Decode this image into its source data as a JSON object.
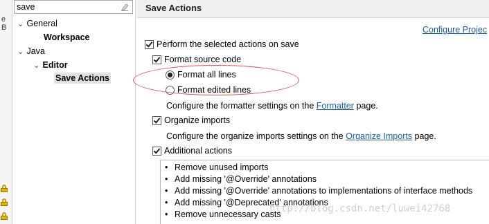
{
  "search": {
    "value": "save"
  },
  "left_edge": {
    "cut_label": "e B"
  },
  "tree": {
    "general": "General",
    "workspace": "Workspace",
    "java": "Java",
    "editor": "Editor",
    "save_actions": "Save Actions"
  },
  "page": {
    "title": "Save Actions",
    "configure_link": "Configure Projec",
    "perform_label": "Perform the selected actions on save",
    "format_source_label": "Format source code",
    "format_all_label": "Format all lines",
    "format_edited_label": "Format edited lines",
    "formatter_text_pre": "Configure the formatter settings on the ",
    "formatter_link": "Formatter",
    "formatter_text_post": " page.",
    "organize_imports_label": "Organize imports",
    "organize_text_pre": "Configure the organize imports settings on the ",
    "organize_link": "Organize Imports",
    "organize_text_post": " page.",
    "additional_label": "Additional actions",
    "actions": [
      "Remove unused imports",
      "Add missing '@Override' annotations",
      "Add missing '@Override' annotations to implementations of interface methods",
      "Add missing '@Deprecated' annotations",
      "Remove unnecessary casts"
    ]
  },
  "watermark": "http://blog.csdn.net/luwei42768",
  "colors": {
    "link": "#1a5ea8",
    "highlight_ellipse": "#d9534f",
    "selected_bg": "#e1e1e1"
  }
}
